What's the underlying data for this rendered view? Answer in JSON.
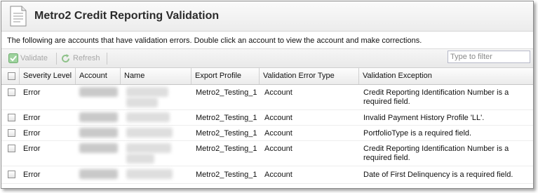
{
  "window": {
    "title": "Metro2 Credit Reporting Validation",
    "description": "The following are accounts that have validation errors. Double click an account to view the account and make corrections."
  },
  "toolbar": {
    "validate_label": "Validate",
    "refresh_label": "Refresh",
    "filter_placeholder": "Type to filter"
  },
  "grid": {
    "columns": [
      "Severity Level",
      "Account",
      "Name",
      "Export Profile",
      "Validation Error Type",
      "Validation Exception"
    ],
    "rows": [
      {
        "severity": "Error",
        "export_profile": "Metro2_Testing_1",
        "error_type": "Account",
        "exception": "Credit Reporting Identification Number is a required field."
      },
      {
        "severity": "Error",
        "export_profile": "Metro2_Testing_1",
        "error_type": "Account",
        "exception": "Invalid Payment History Profile 'LL'."
      },
      {
        "severity": "Error",
        "export_profile": "Metro2_Testing_1",
        "error_type": "Account",
        "exception": "PortfolioType is a required field."
      },
      {
        "severity": "Error",
        "export_profile": "Metro2_Testing_1",
        "error_type": "Account",
        "exception": "Credit Reporting Identification Number is a required field."
      },
      {
        "severity": "Error",
        "export_profile": "Metro2_Testing_1",
        "error_type": "Account",
        "exception": "Date of First Delinquency is a required field."
      }
    ]
  },
  "icons": {
    "title": "document-icon",
    "validate": "checkmark-icon",
    "refresh": "refresh-icon"
  },
  "colors": {
    "disabled_text": "#a8a8a8",
    "validate_icon": "#5cb85c",
    "refresh_icon": "#6aa84f"
  }
}
